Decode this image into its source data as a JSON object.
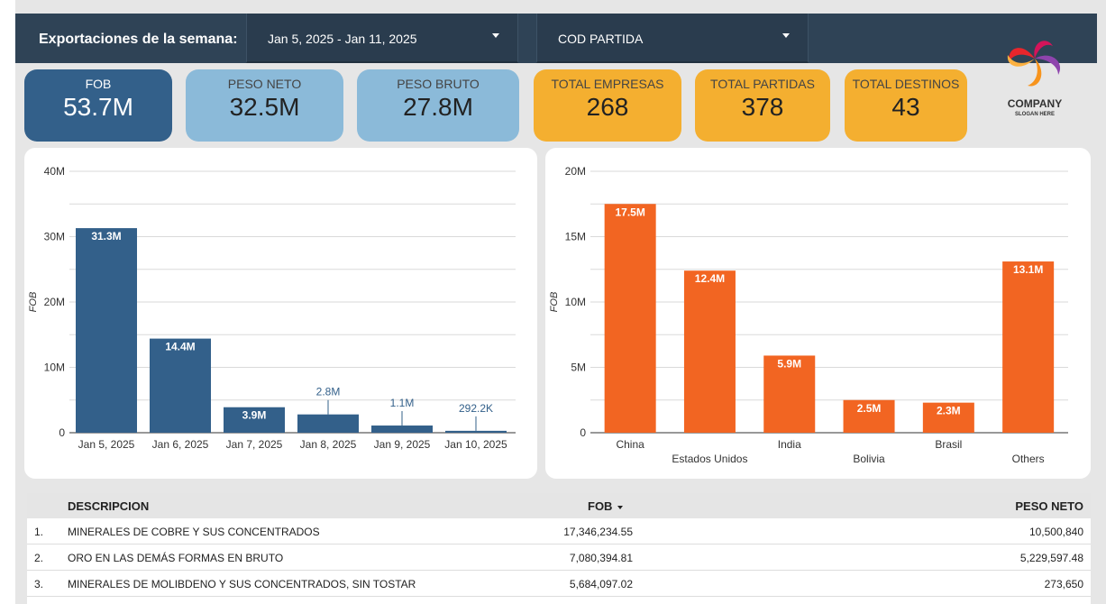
{
  "header": {
    "title": "Exportaciones de la semana:",
    "date_range": "Jan 5, 2025 - Jan 11, 2025",
    "cod_partida": "COD PARTIDA"
  },
  "kpis": [
    {
      "label": "FOB",
      "value": "53.7M"
    },
    {
      "label": "PESO NETO",
      "value": "32.5M"
    },
    {
      "label": "PESO BRUTO",
      "value": "27.8M"
    },
    {
      "label": "TOTAL EMPRESAS",
      "value": "268"
    },
    {
      "label": "TOTAL PARTIDAS",
      "value": "378"
    },
    {
      "label": "TOTAL DESTINOS",
      "value": "43"
    }
  ],
  "logo": {
    "name": "COMPANY",
    "slogan": "SLOGAN HERE"
  },
  "colors": {
    "header": "#2f4356",
    "fob_bar": "#33608a",
    "destinos_bar": "#f26522",
    "kpi_blue": "#8bbad9",
    "kpi_orange": "#f4af30"
  },
  "chart_data": [
    {
      "type": "bar",
      "categories": [
        "Jan 5, 2025",
        "Jan 6, 2025",
        "Jan 7, 2025",
        "Jan 8, 2025",
        "Jan 9, 2025",
        "Jan 10, 2025"
      ],
      "values": [
        31300000,
        14400000,
        3900000,
        2800000,
        1100000,
        292200
      ],
      "labels": [
        "31.3M",
        "14.4M",
        "3.9M",
        "2.8M",
        "1.1M",
        "292.2K"
      ],
      "ylabel": "FOB",
      "ylim": [
        0,
        40000000
      ],
      "yticks": [
        "0",
        "10M",
        "20M",
        "30M",
        "40M"
      ],
      "grid": true
    },
    {
      "type": "bar",
      "categories": [
        "China",
        "Estados Unidos",
        "India",
        "Bolivia",
        "Brasil",
        "Others"
      ],
      "values": [
        17500000,
        12400000,
        5900000,
        2500000,
        2300000,
        13100000
      ],
      "labels": [
        "17.5M",
        "12.4M",
        "5.9M",
        "2.5M",
        "2.3M",
        "13.1M"
      ],
      "ylabel": "FOB",
      "ylim": [
        0,
        20000000
      ],
      "yticks": [
        "0",
        "5M",
        "10M",
        "15M",
        "20M"
      ],
      "grid": true
    }
  ],
  "table": {
    "columns": [
      "DESCRIPCION",
      "FOB",
      "PESO NETO"
    ],
    "rows": [
      {
        "idx": "1.",
        "desc": "MINERALES DE COBRE Y SUS CONCENTRADOS",
        "fob": "17,346,234.55",
        "peso": "10,500,840"
      },
      {
        "idx": "2.",
        "desc": "ORO EN LAS DEMÁS FORMAS EN BRUTO",
        "fob": "7,080,394.81",
        "peso": "5,229,597.48"
      },
      {
        "idx": "3.",
        "desc": "MINERALES DE MOLIBDENO Y SUS CONCENTRADOS, SIN TOSTAR",
        "fob": "5,684,097.02",
        "peso": "273,650"
      }
    ]
  }
}
